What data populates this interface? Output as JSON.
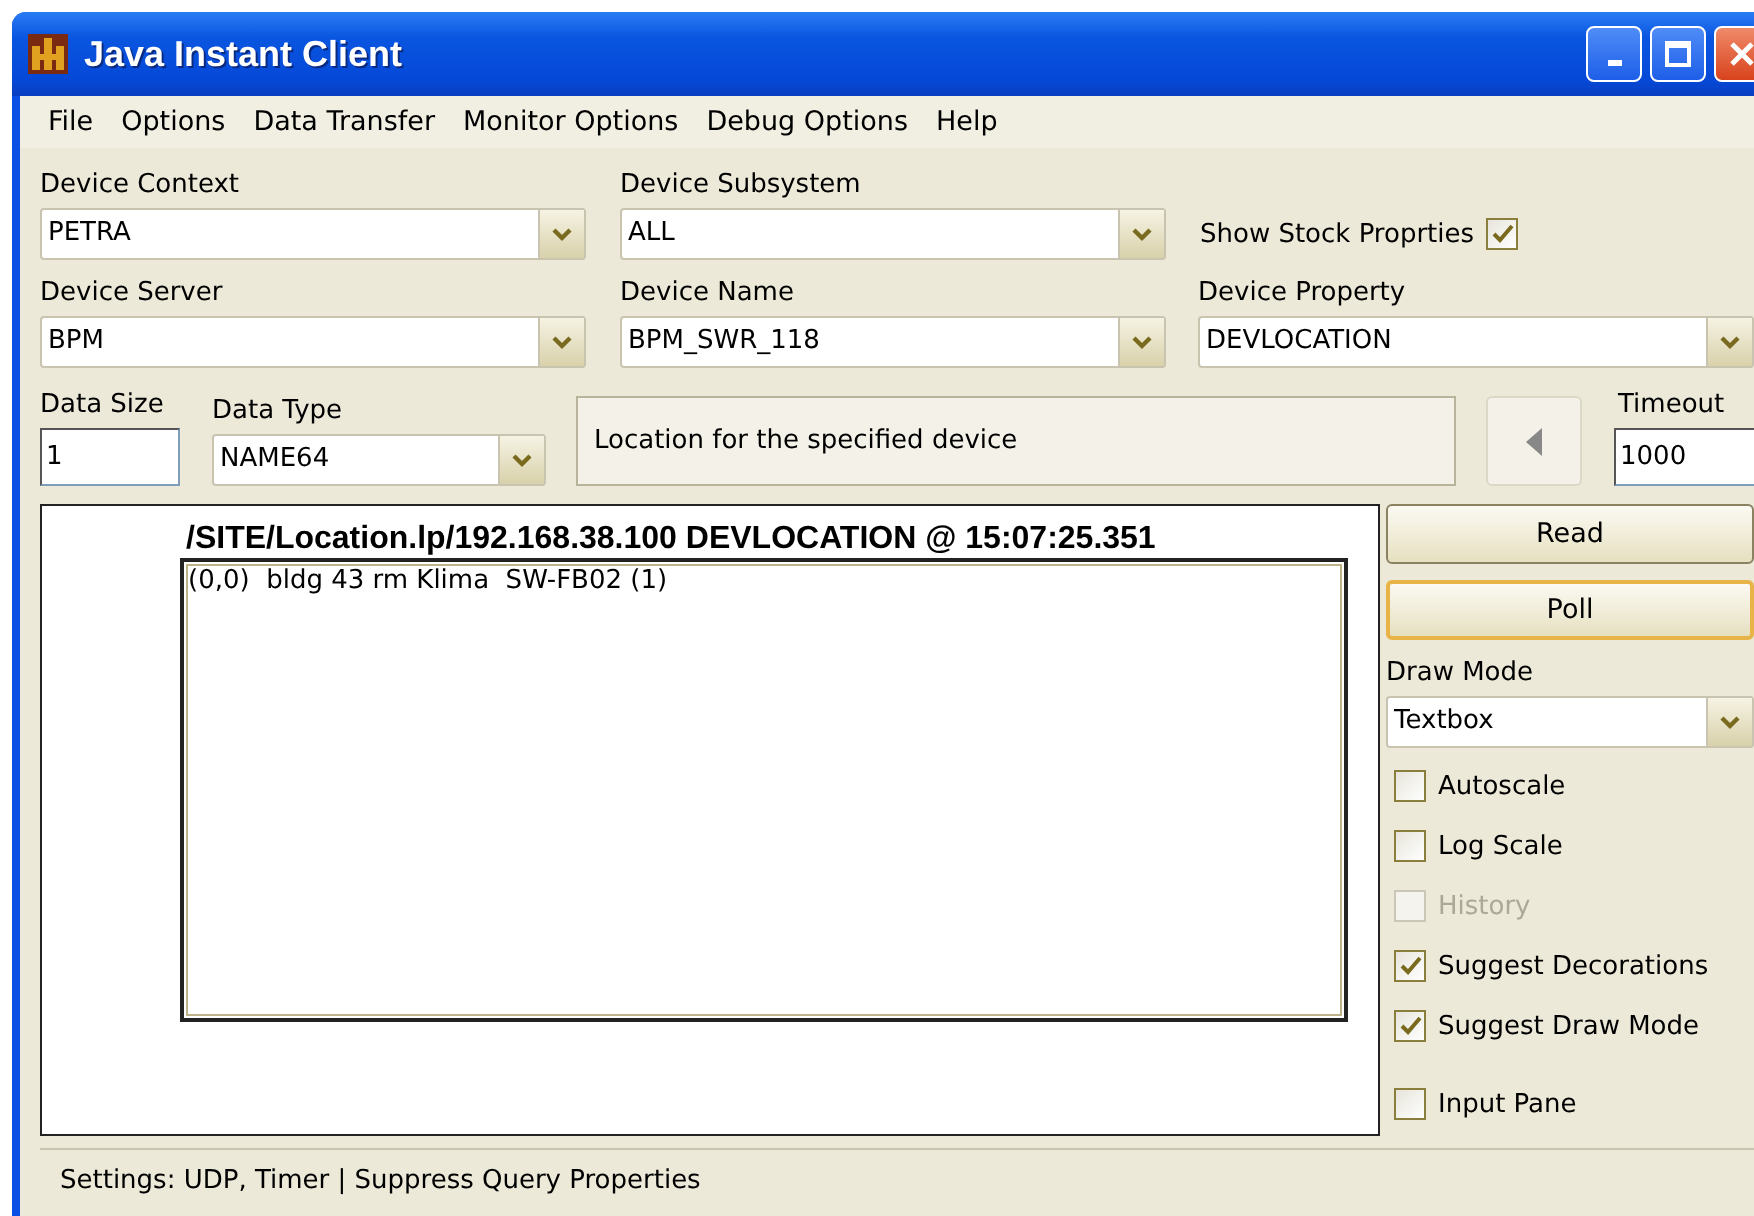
{
  "window": {
    "title": "Java Instant Client"
  },
  "menu": [
    "File",
    "Options",
    "Data Transfer",
    "Monitor Options",
    "Debug Options",
    "Help"
  ],
  "device_context": {
    "label": "Device Context",
    "value": "PETRA"
  },
  "device_subsystem": {
    "label": "Device Subsystem",
    "value": "ALL"
  },
  "show_stock_properties": {
    "label": "Show Stock Proprties",
    "checked": true
  },
  "device_server": {
    "label": "Device Server",
    "value": "BPM"
  },
  "device_name": {
    "label": "Device Name",
    "value": "BPM_SWR_118"
  },
  "device_property": {
    "label": "Device Property",
    "value": "DEVLOCATION"
  },
  "data_size": {
    "label": "Data Size",
    "value": "1"
  },
  "data_type": {
    "label": "Data Type",
    "value": "NAME64"
  },
  "description": "Location for the specified device",
  "timeout": {
    "label": "Timeout",
    "value": "1000"
  },
  "display": {
    "title": "/SITE/Location.lp/192.168.38.100 DEVLOCATION @ 15:07:25.351",
    "lines": [
      "(0,0)  bldg 43 rm Klima  SW-FB02 (1)"
    ]
  },
  "buttons": [
    {
      "label": "Read",
      "focused": false
    },
    {
      "label": "Poll",
      "focused": true
    }
  ],
  "draw_mode": {
    "label": "Draw Mode",
    "value": "Textbox"
  },
  "options": [
    {
      "label": "Autoscale",
      "checked": false,
      "disabled": false
    },
    {
      "label": "Log Scale",
      "checked": false,
      "disabled": false
    },
    {
      "label": "History",
      "checked": false,
      "disabled": true
    },
    {
      "label": "Suggest Decorations",
      "checked": true,
      "disabled": false
    },
    {
      "label": "Suggest Draw Mode",
      "checked": true,
      "disabled": false
    },
    {
      "label": "Input Pane",
      "checked": false,
      "disabled": false
    }
  ],
  "status_bar": "Settings: UDP, Timer | Suppress Query Properties"
}
